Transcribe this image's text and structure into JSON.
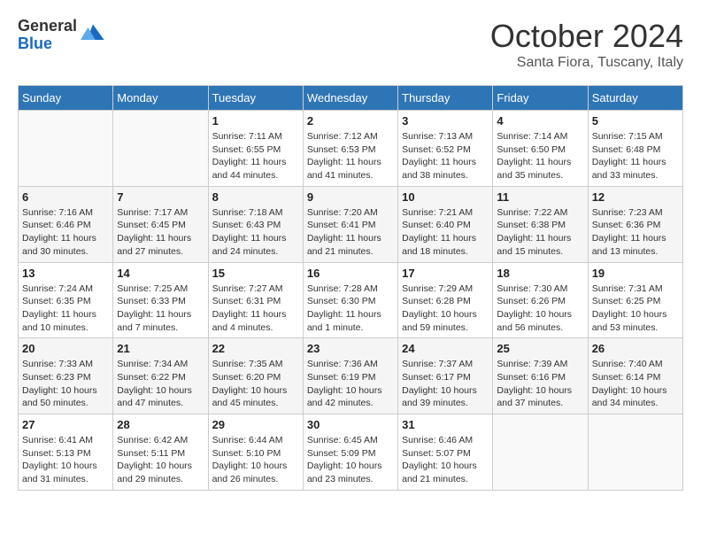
{
  "logo": {
    "general": "General",
    "blue": "Blue"
  },
  "title": "October 2024",
  "location": "Santa Fiora, Tuscany, Italy",
  "days_of_week": [
    "Sunday",
    "Monday",
    "Tuesday",
    "Wednesday",
    "Thursday",
    "Friday",
    "Saturday"
  ],
  "weeks": [
    [
      {
        "day": "",
        "sunrise": "",
        "sunset": "",
        "daylight": ""
      },
      {
        "day": "",
        "sunrise": "",
        "sunset": "",
        "daylight": ""
      },
      {
        "day": "1",
        "sunrise": "Sunrise: 7:11 AM",
        "sunset": "Sunset: 6:55 PM",
        "daylight": "Daylight: 11 hours and 44 minutes."
      },
      {
        "day": "2",
        "sunrise": "Sunrise: 7:12 AM",
        "sunset": "Sunset: 6:53 PM",
        "daylight": "Daylight: 11 hours and 41 minutes."
      },
      {
        "day": "3",
        "sunrise": "Sunrise: 7:13 AM",
        "sunset": "Sunset: 6:52 PM",
        "daylight": "Daylight: 11 hours and 38 minutes."
      },
      {
        "day": "4",
        "sunrise": "Sunrise: 7:14 AM",
        "sunset": "Sunset: 6:50 PM",
        "daylight": "Daylight: 11 hours and 35 minutes."
      },
      {
        "day": "5",
        "sunrise": "Sunrise: 7:15 AM",
        "sunset": "Sunset: 6:48 PM",
        "daylight": "Daylight: 11 hours and 33 minutes."
      }
    ],
    [
      {
        "day": "6",
        "sunrise": "Sunrise: 7:16 AM",
        "sunset": "Sunset: 6:46 PM",
        "daylight": "Daylight: 11 hours and 30 minutes."
      },
      {
        "day": "7",
        "sunrise": "Sunrise: 7:17 AM",
        "sunset": "Sunset: 6:45 PM",
        "daylight": "Daylight: 11 hours and 27 minutes."
      },
      {
        "day": "8",
        "sunrise": "Sunrise: 7:18 AM",
        "sunset": "Sunset: 6:43 PM",
        "daylight": "Daylight: 11 hours and 24 minutes."
      },
      {
        "day": "9",
        "sunrise": "Sunrise: 7:20 AM",
        "sunset": "Sunset: 6:41 PM",
        "daylight": "Daylight: 11 hours and 21 minutes."
      },
      {
        "day": "10",
        "sunrise": "Sunrise: 7:21 AM",
        "sunset": "Sunset: 6:40 PM",
        "daylight": "Daylight: 11 hours and 18 minutes."
      },
      {
        "day": "11",
        "sunrise": "Sunrise: 7:22 AM",
        "sunset": "Sunset: 6:38 PM",
        "daylight": "Daylight: 11 hours and 15 minutes."
      },
      {
        "day": "12",
        "sunrise": "Sunrise: 7:23 AM",
        "sunset": "Sunset: 6:36 PM",
        "daylight": "Daylight: 11 hours and 13 minutes."
      }
    ],
    [
      {
        "day": "13",
        "sunrise": "Sunrise: 7:24 AM",
        "sunset": "Sunset: 6:35 PM",
        "daylight": "Daylight: 11 hours and 10 minutes."
      },
      {
        "day": "14",
        "sunrise": "Sunrise: 7:25 AM",
        "sunset": "Sunset: 6:33 PM",
        "daylight": "Daylight: 11 hours and 7 minutes."
      },
      {
        "day": "15",
        "sunrise": "Sunrise: 7:27 AM",
        "sunset": "Sunset: 6:31 PM",
        "daylight": "Daylight: 11 hours and 4 minutes."
      },
      {
        "day": "16",
        "sunrise": "Sunrise: 7:28 AM",
        "sunset": "Sunset: 6:30 PM",
        "daylight": "Daylight: 11 hours and 1 minute."
      },
      {
        "day": "17",
        "sunrise": "Sunrise: 7:29 AM",
        "sunset": "Sunset: 6:28 PM",
        "daylight": "Daylight: 10 hours and 59 minutes."
      },
      {
        "day": "18",
        "sunrise": "Sunrise: 7:30 AM",
        "sunset": "Sunset: 6:26 PM",
        "daylight": "Daylight: 10 hours and 56 minutes."
      },
      {
        "day": "19",
        "sunrise": "Sunrise: 7:31 AM",
        "sunset": "Sunset: 6:25 PM",
        "daylight": "Daylight: 10 hours and 53 minutes."
      }
    ],
    [
      {
        "day": "20",
        "sunrise": "Sunrise: 7:33 AM",
        "sunset": "Sunset: 6:23 PM",
        "daylight": "Daylight: 10 hours and 50 minutes."
      },
      {
        "day": "21",
        "sunrise": "Sunrise: 7:34 AM",
        "sunset": "Sunset: 6:22 PM",
        "daylight": "Daylight: 10 hours and 47 minutes."
      },
      {
        "day": "22",
        "sunrise": "Sunrise: 7:35 AM",
        "sunset": "Sunset: 6:20 PM",
        "daylight": "Daylight: 10 hours and 45 minutes."
      },
      {
        "day": "23",
        "sunrise": "Sunrise: 7:36 AM",
        "sunset": "Sunset: 6:19 PM",
        "daylight": "Daylight: 10 hours and 42 minutes."
      },
      {
        "day": "24",
        "sunrise": "Sunrise: 7:37 AM",
        "sunset": "Sunset: 6:17 PM",
        "daylight": "Daylight: 10 hours and 39 minutes."
      },
      {
        "day": "25",
        "sunrise": "Sunrise: 7:39 AM",
        "sunset": "Sunset: 6:16 PM",
        "daylight": "Daylight: 10 hours and 37 minutes."
      },
      {
        "day": "26",
        "sunrise": "Sunrise: 7:40 AM",
        "sunset": "Sunset: 6:14 PM",
        "daylight": "Daylight: 10 hours and 34 minutes."
      }
    ],
    [
      {
        "day": "27",
        "sunrise": "Sunrise: 6:41 AM",
        "sunset": "Sunset: 5:13 PM",
        "daylight": "Daylight: 10 hours and 31 minutes."
      },
      {
        "day": "28",
        "sunrise": "Sunrise: 6:42 AM",
        "sunset": "Sunset: 5:11 PM",
        "daylight": "Daylight: 10 hours and 29 minutes."
      },
      {
        "day": "29",
        "sunrise": "Sunrise: 6:44 AM",
        "sunset": "Sunset: 5:10 PM",
        "daylight": "Daylight: 10 hours and 26 minutes."
      },
      {
        "day": "30",
        "sunrise": "Sunrise: 6:45 AM",
        "sunset": "Sunset: 5:09 PM",
        "daylight": "Daylight: 10 hours and 23 minutes."
      },
      {
        "day": "31",
        "sunrise": "Sunrise: 6:46 AM",
        "sunset": "Sunset: 5:07 PM",
        "daylight": "Daylight: 10 hours and 21 minutes."
      },
      {
        "day": "",
        "sunrise": "",
        "sunset": "",
        "daylight": ""
      },
      {
        "day": "",
        "sunrise": "",
        "sunset": "",
        "daylight": ""
      }
    ]
  ]
}
